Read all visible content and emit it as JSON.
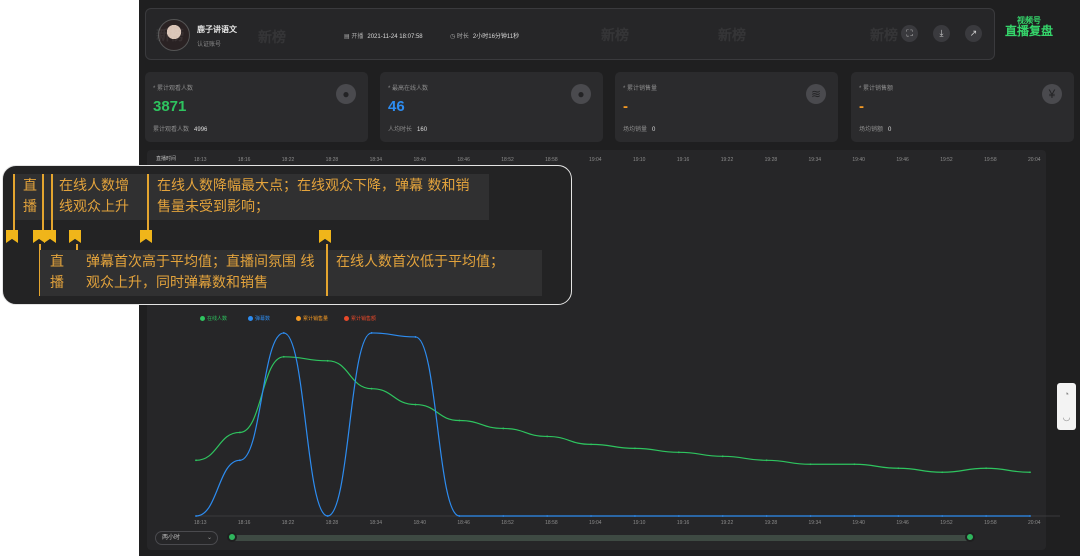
{
  "header": {
    "anchor_name": "鹿子讲语文",
    "anchor_tag": "认证账号",
    "start_label": "开播",
    "start_time": "2021-11-24 18:07:58",
    "duration_label": "时长",
    "duration": "2小时16分钟11秒",
    "watermark": "新榜",
    "brand_line1": "视频号",
    "brand_line2": "直播复盘",
    "icons": [
      "fullscreen-icon",
      "download-icon",
      "share-icon"
    ]
  },
  "cards": [
    {
      "label": "* 累计观看人数",
      "value": "3871",
      "value_color": "#2ec45f",
      "sub_label": "累计观看人数",
      "sub_value": "4996",
      "icon": "user-icon"
    },
    {
      "label": "* 最高在线人数",
      "value": "46",
      "value_color": "#2d8cf0",
      "sub_label": "人均时长",
      "sub_value": "160",
      "icon": "user-icon"
    },
    {
      "label": "* 累计销售量",
      "value": "-",
      "value_color": "#f59a23",
      "sub_label": "场均销量",
      "sub_value": "0",
      "icon": "layers-icon"
    },
    {
      "label": "* 累计销售额",
      "value": "-",
      "value_color": "#f59a23",
      "sub_label": "场均销额",
      "sub_value": "0",
      "icon": "yen-icon"
    }
  ],
  "chart_header": "直播时间",
  "chart_data": {
    "type": "line",
    "x": [
      "18:13",
      "18:16",
      "18:22",
      "18:28",
      "18:34",
      "18:40",
      "18:46",
      "18:52",
      "18:58",
      "19:04",
      "19:10",
      "19:16",
      "19:22",
      "19:28",
      "19:34",
      "19:40",
      "19:46",
      "19:52",
      "19:58",
      "20:04"
    ],
    "legend_position": "top-left",
    "series": [
      {
        "name": "在线人数",
        "color": "#2ec45f",
        "values": [
          14,
          21,
          40,
          39,
          32,
          28,
          24,
          22,
          20,
          18,
          17,
          16,
          15,
          14,
          13,
          13,
          12,
          11,
          12,
          11
        ]
      },
      {
        "name": "弹幕数",
        "color": "#2d8cf0",
        "values": [
          0,
          14,
          46,
          0,
          46,
          45,
          0,
          0,
          0,
          0,
          0,
          0,
          0,
          0,
          0,
          0,
          0,
          0,
          0,
          0
        ]
      },
      {
        "name": "累计销售量",
        "color": "#f59a23",
        "values": []
      },
      {
        "name": "累计销售额",
        "color": "#e8492a",
        "values": []
      }
    ]
  },
  "time_select": "两小时",
  "side_tools": [
    "chat-icon",
    "headset-icon"
  ],
  "notes": [
    {
      "text": "直播 幕数"
    },
    {
      "text": "在线人数增 线观众上升"
    },
    {
      "text": "在线人数降幅最大点；在线观众下降，弹幕 数和销售量未受到影响；"
    },
    {
      "text": "直播 幕数"
    },
    {
      "text": "弹幕首次高于平均值；直播间氛围 线观众上升，同时弹幕数和销售"
    },
    {
      "text": "在线人数首次低于平均值；"
    }
  ]
}
